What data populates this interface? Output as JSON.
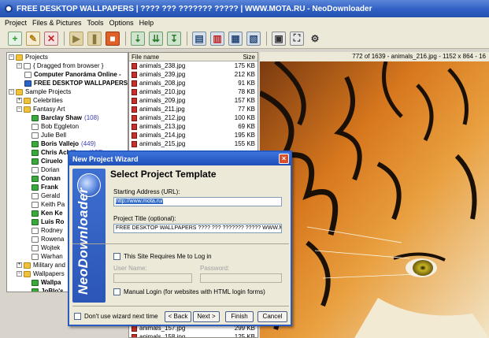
{
  "window": {
    "title": "FREE DESKTOP WALLPAPERS | ???? ??? ??????? ????? | WWW.MOTA.RU - NeoDownloader"
  },
  "menu": [
    "Project",
    "Files & Pictures",
    "Tools",
    "Options",
    "Help"
  ],
  "tree": {
    "root": "Projects",
    "dragged": "{ Dragged from browser }",
    "computer": "Computer Panoráma Online -",
    "free_desktop": "FREE DESKTOP WALLPAPERS |",
    "sample": "Sample Projects",
    "celebrities": "Celebrities",
    "fantasy": "Fantasy Art",
    "items": [
      {
        "label": "Barclay Shaw",
        "count": "(108)",
        "bold": true,
        "icon": "check"
      },
      {
        "label": "Bob Eggleton",
        "count": "",
        "bold": false,
        "icon": "page"
      },
      {
        "label": "Julie Bell",
        "count": "",
        "bold": false,
        "icon": "page"
      },
      {
        "label": "Boris Vallejo",
        "count": "(449)",
        "bold": true,
        "icon": "check"
      },
      {
        "label": "Chris Achilleos",
        "count": "(197)",
        "bold": true,
        "icon": "check"
      },
      {
        "label": "Ciruelo",
        "count": "",
        "bold": true,
        "icon": "check"
      },
      {
        "label": "Dorian",
        "count": "",
        "bold": false,
        "icon": "page"
      },
      {
        "label": "Conan",
        "count": "",
        "bold": true,
        "icon": "check"
      },
      {
        "label": "Frank",
        "count": "",
        "bold": true,
        "icon": "check"
      },
      {
        "label": "Gerald",
        "count": "",
        "bold": false,
        "icon": "page"
      },
      {
        "label": "Keith Pa",
        "count": "",
        "bold": false,
        "icon": "page"
      },
      {
        "label": "Ken Ke",
        "count": "",
        "bold": true,
        "icon": "check"
      },
      {
        "label": "Luis Ro",
        "count": "",
        "bold": true,
        "icon": "check"
      },
      {
        "label": "Rodney",
        "count": "",
        "bold": false,
        "icon": "page"
      },
      {
        "label": "Rowena",
        "count": "",
        "bold": false,
        "icon": "page"
      },
      {
        "label": "Wojtek",
        "count": "",
        "bold": false,
        "icon": "page"
      },
      {
        "label": "Warhan",
        "count": "",
        "bold": false,
        "icon": "page"
      }
    ],
    "military": "Military and",
    "wallpapers": "Wallpapers",
    "wp_items": [
      {
        "label": "Wallpa",
        "bold": true,
        "icon": "check"
      },
      {
        "label": "JoBlo's",
        "bold": true,
        "icon": "check"
      },
      {
        "label": "Wallpa",
        "bold": true,
        "icon": "check"
      },
      {
        "label": "Wallpap",
        "bold": false,
        "icon": "page"
      }
    ]
  },
  "files": {
    "header_name": "File name",
    "header_size": "Size",
    "rows": [
      {
        "name": "animals_238.jpg",
        "size": "175 KB"
      },
      {
        "name": "animals_239.jpg",
        "size": "212 KB"
      },
      {
        "name": "animals_208.jpg",
        "size": "91 KB"
      },
      {
        "name": "animals_210.jpg",
        "size": "78 KB"
      },
      {
        "name": "animals_209.jpg",
        "size": "157 KB"
      },
      {
        "name": "animals_211.jpg",
        "size": "77 KB"
      },
      {
        "name": "animals_212.jpg",
        "size": "100 KB"
      },
      {
        "name": "animals_213.jpg",
        "size": "69 KB"
      },
      {
        "name": "animals_214.jpg",
        "size": "195 KB"
      },
      {
        "name": "animals_215.jpg",
        "size": "155 KB"
      }
    ],
    "bottom_rows": [
      {
        "name": "animals_157.jpg",
        "size": "299 KB"
      },
      {
        "name": "animals_158.jpg",
        "size": "125 KB"
      }
    ]
  },
  "viewer": {
    "caption": "772 of 1639 - animals_216.jpg - 1152 x 864 - 16"
  },
  "wizard": {
    "title": "New Project Wizard",
    "heading": "Select Project Template",
    "side_text": "NeoDownloader",
    "url_label": "Starting Address (URL):",
    "url_value": "http://www.mota.ru/",
    "title_label": "Project Title (optional):",
    "title_value": "FREE DESKTOP WALLPAPERS  ???? ??? ??????? ?????  WWW.MOTA.",
    "login_check": "This Site Requires Me to Log in",
    "user_label": "User Name:",
    "password_label": "Password:",
    "manual_login": "Manual Login (for websites with HTML login forms)",
    "dont_use": "Don't use wizard next time",
    "back": "< Back",
    "next": "Next >",
    "finish": "Finish",
    "cancel": "Cancel",
    "close": "×"
  }
}
